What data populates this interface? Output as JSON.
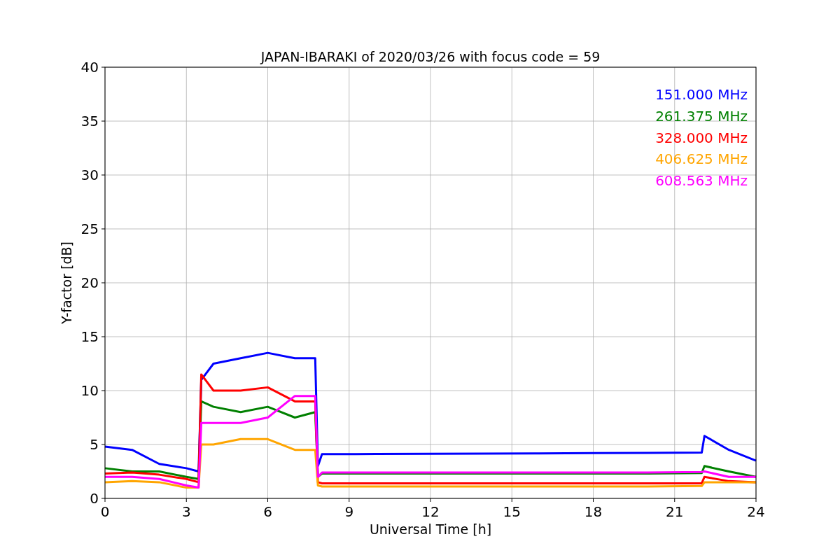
{
  "figure": {
    "chart_data": {
      "type": "line",
      "title": "JAPAN-IBARAKI of 2020/03/26 with focus code = 59",
      "xlabel": "Universal Time [h]",
      "ylabel": "Y-factor [dB]",
      "x": [
        0,
        1,
        2,
        3,
        3.45,
        3.55,
        4,
        5,
        6,
        7,
        7.75,
        7.85,
        8,
        10,
        12,
        14,
        16,
        18,
        20,
        22,
        22.1,
        23,
        24
      ],
      "series": [
        {
          "name": "151.000 MHz",
          "color": "#0000ff",
          "values": [
            4.8,
            4.5,
            3.2,
            2.8,
            2.5,
            11,
            12.5,
            13,
            13.5,
            13,
            13,
            3,
            4.1,
            4.12,
            4.14,
            4.16,
            4.18,
            4.2,
            4.22,
            4.25,
            5.8,
            4.5,
            3.5
          ]
        },
        {
          "name": "261.375 MHz",
          "color": "#008000",
          "values": [
            2.8,
            2.5,
            2.5,
            2,
            1.8,
            9,
            8.5,
            8,
            8.5,
            7.5,
            8,
            2,
            2.3,
            2.3,
            2.3,
            2.3,
            2.3,
            2.3,
            2.3,
            2.35,
            3,
            2.5,
            2
          ]
        },
        {
          "name": "328.000 MHz",
          "color": "#ff0000",
          "values": [
            2.3,
            2.4,
            2.2,
            1.8,
            1.5,
            11.5,
            10,
            10,
            10.3,
            9,
            9,
            1.5,
            1.4,
            1.4,
            1.4,
            1.4,
            1.4,
            1.4,
            1.4,
            1.4,
            2,
            1.6,
            1.5
          ]
        },
        {
          "name": "406.625 MHz",
          "color": "#ffa500",
          "values": [
            1.5,
            1.6,
            1.5,
            1,
            1,
            5,
            5,
            5.5,
            5.5,
            4.5,
            4.5,
            1.2,
            1.1,
            1.1,
            1.1,
            1.1,
            1.1,
            1.1,
            1.1,
            1.15,
            1.5,
            1.5,
            1.5
          ]
        },
        {
          "name": "608.563 MHz",
          "color": "#ff00ff",
          "values": [
            2,
            2,
            1.8,
            1.2,
            1,
            7,
            7,
            7,
            7.5,
            9.5,
            9.5,
            2,
            2.4,
            2.4,
            2.4,
            2.4,
            2.4,
            2.4,
            2.4,
            2.45,
            2.5,
            2,
            2
          ]
        }
      ],
      "grid": true,
      "xlim": [
        0,
        24
      ],
      "ylim": [
        0,
        40
      ],
      "xticks": [
        0,
        3,
        6,
        9,
        12,
        15,
        18,
        21,
        24
      ],
      "yticks": [
        0,
        5,
        10,
        15,
        20,
        25,
        30,
        35,
        40
      ]
    }
  }
}
